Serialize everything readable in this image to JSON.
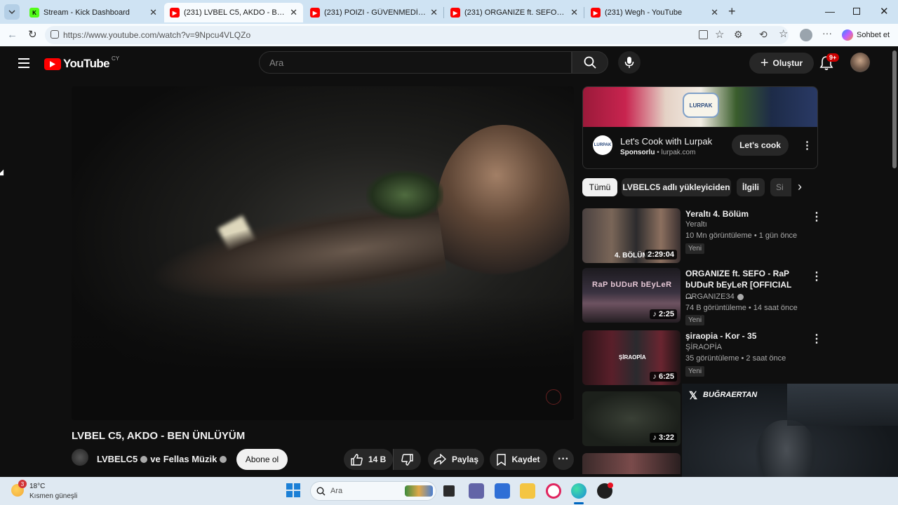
{
  "browser": {
    "tabs": [
      {
        "title": "Stream - Kick Dashboard",
        "fav_color": "#53fc18",
        "fav_text": "K"
      },
      {
        "title": "(231) LVBEL C5, AKDO - BEN ÜNLÜ",
        "fav_color": "#ff0000",
        "fav_text": "▶"
      },
      {
        "title": "(231) POIZI - GÜVENMEDİN (Offici",
        "fav_color": "#ff0000",
        "fav_text": "▶"
      },
      {
        "title": "(231) ORGANIZE ft. SEFO - RaP bU",
        "fav_color": "#ff0000",
        "fav_text": "▶"
      },
      {
        "title": "(231) Wegh - YouTube",
        "fav_color": "#ff0000",
        "fav_text": "▶"
      }
    ],
    "url": "https://www.youtube.com/watch?v=9Npcu4VLQZo",
    "copilot_label": "Sohbet et"
  },
  "yt": {
    "logo_text": "YouTube",
    "country": "CY",
    "search_placeholder": "Ara",
    "create_label": "Oluştur",
    "notif_count": "9+"
  },
  "video": {
    "title": "LVBEL C5, AKDO - BEN ÜNLÜYÜM",
    "channel": "LVBELC5",
    "channel_and": "ve",
    "channel2": "Fellas Müzik",
    "subscribe_label": "Abone ol",
    "likes": "14 B",
    "share_label": "Paylaş",
    "save_label": "Kaydet"
  },
  "ad": {
    "title": "Let's Cook with Lurpak",
    "sponsored": "Sponsorlu",
    "domain": "lurpak.com",
    "cta": "Let's cook",
    "brand": "LURPAK"
  },
  "chips": [
    "Tümü",
    "LVBELC5 adlı yükleyiciden",
    "İlgili",
    "Si"
  ],
  "recommendations": [
    {
      "title": "Yeraltı 4. Bölüm",
      "channel": "Yeraltı",
      "meta": "10 Mn görüntüleme • 1 gün önce",
      "badge": "Yeni",
      "duration": "2:29:04",
      "thumb_text": "4. BÖLÜM"
    },
    {
      "title": "ORGANIZE ft. SEFO - RaP bUDuR bEyLeR [OFFICIAL ...",
      "channel": "ORGANIZE34",
      "meta": "74 B görüntüleme • 14 saat önce",
      "badge": "Yeni",
      "duration": "2:25",
      "thumb_text": "RaP bUDuR bEyLeR"
    },
    {
      "title": "şiraopia - Kor - 35",
      "channel": "ŞİRAOPİA",
      "meta": "35 görüntüleme • 2 saat önce",
      "badge": "Yeni",
      "duration": "6:25",
      "thumb_text": "ŞİRAOPİA"
    },
    {
      "duration": "3:22"
    }
  ],
  "overlay": {
    "handle": "BUĞRAERTAN"
  },
  "taskbar": {
    "temp": "18°C",
    "weather": "Kısmen güneşli",
    "weather_badge": "3",
    "search_label": "Ara"
  }
}
